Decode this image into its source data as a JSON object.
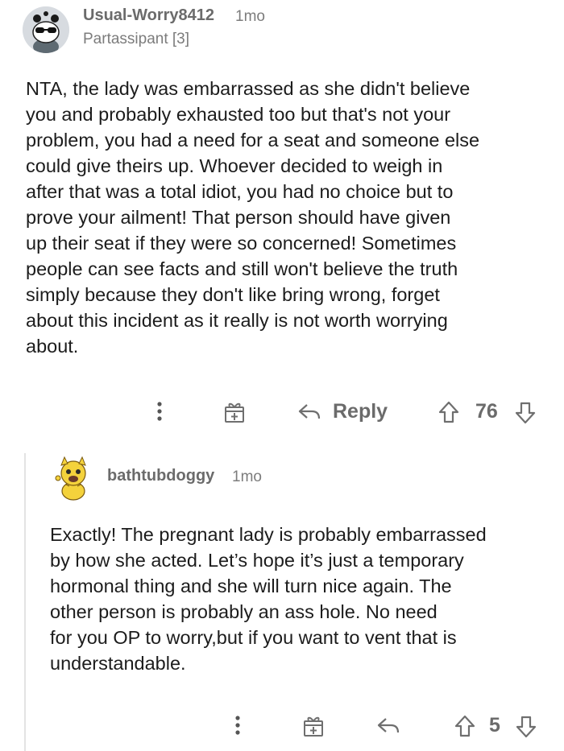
{
  "comment": {
    "username": "Usual-Worry8412",
    "time": "1mo",
    "flair": "Partassipant [3]",
    "body": "NTA, the lady was embarrassed as she didn't believe\nyou and probably exhausted too but that's not your\nproblem, you had a need for a seat and someone else\ncould give theirs up. Whoever decided to weigh in\nafter that was a total idiot, you had no choice but to\nprove your ailment! That person should have given\nup their seat if they were so concerned! Sometimes\npeople can see facts and still won't believe the truth\nsimply because they don't like bring wrong, forget\nabout this incident as it really is not worth worrying\nabout.",
    "reply_label": "Reply",
    "votes": "76"
  },
  "reply": {
    "username": "bathtubdoggy",
    "time": "1mo",
    "body": "Exactly! The pregnant lady is probably embarrassed\nby how she acted. Let’s hope it’s just a temporary\nhormonal thing and she will turn nice again. The\nother person is probably an ass hole. No need\nfor you OP to worry,but if you want to vent that is\nunderstandable.",
    "votes": "5"
  }
}
